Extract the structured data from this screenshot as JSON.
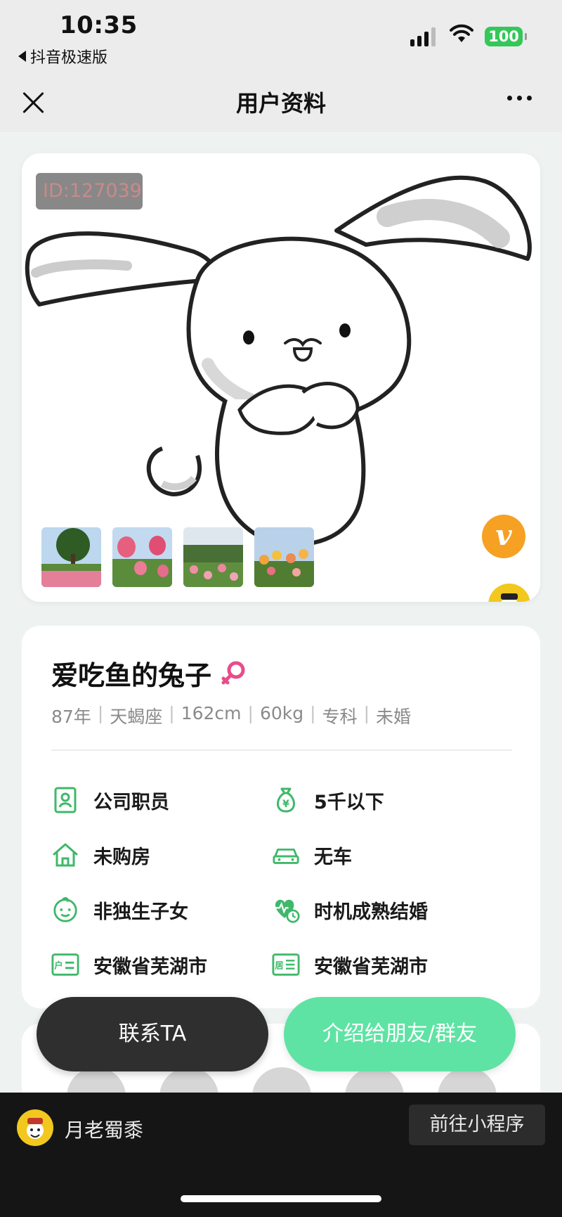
{
  "status_bar": {
    "time": "10:35",
    "back_app": "抖音极速版",
    "battery": "100"
  },
  "navbar": {
    "title": "用户资料"
  },
  "photo": {
    "id_tag": "ID:127039",
    "verified_badge": "v",
    "thumbnail_count": 4
  },
  "profile": {
    "nickname": "爱吃鱼的兔子",
    "gender_icon": "female-icon",
    "basics": [
      "87年",
      "天蝎座",
      "162cm",
      "60kg",
      "专科",
      "未婚"
    ],
    "attributes": [
      {
        "icon": "id-badge-icon",
        "label": "公司职员"
      },
      {
        "icon": "money-bag-icon",
        "label": "5千以下"
      },
      {
        "icon": "house-icon",
        "label": "未购房"
      },
      {
        "icon": "car-icon",
        "label": "无车"
      },
      {
        "icon": "child-face-icon",
        "label": "非独生子女"
      },
      {
        "icon": "heart-clock-icon",
        "label": "时机成熟结婚"
      },
      {
        "icon": "hukou-card-icon",
        "label": "安徽省芜湖市"
      },
      {
        "icon": "residence-card-icon",
        "label": "安徽省芜湖市"
      }
    ],
    "hukou_prefix": "户",
    "residence_prefix": "居"
  },
  "actions": {
    "contact": "联系TA",
    "introduce": "介绍给朋友/群友"
  },
  "mini_program": {
    "name": "月老蜀黍",
    "open_button": "前往小程序"
  },
  "colors": {
    "accent_green": "#3fb86a",
    "intro_button": "#5fe3a4",
    "badge_orange": "#f6a123",
    "female_pink": "#e94c8c"
  }
}
